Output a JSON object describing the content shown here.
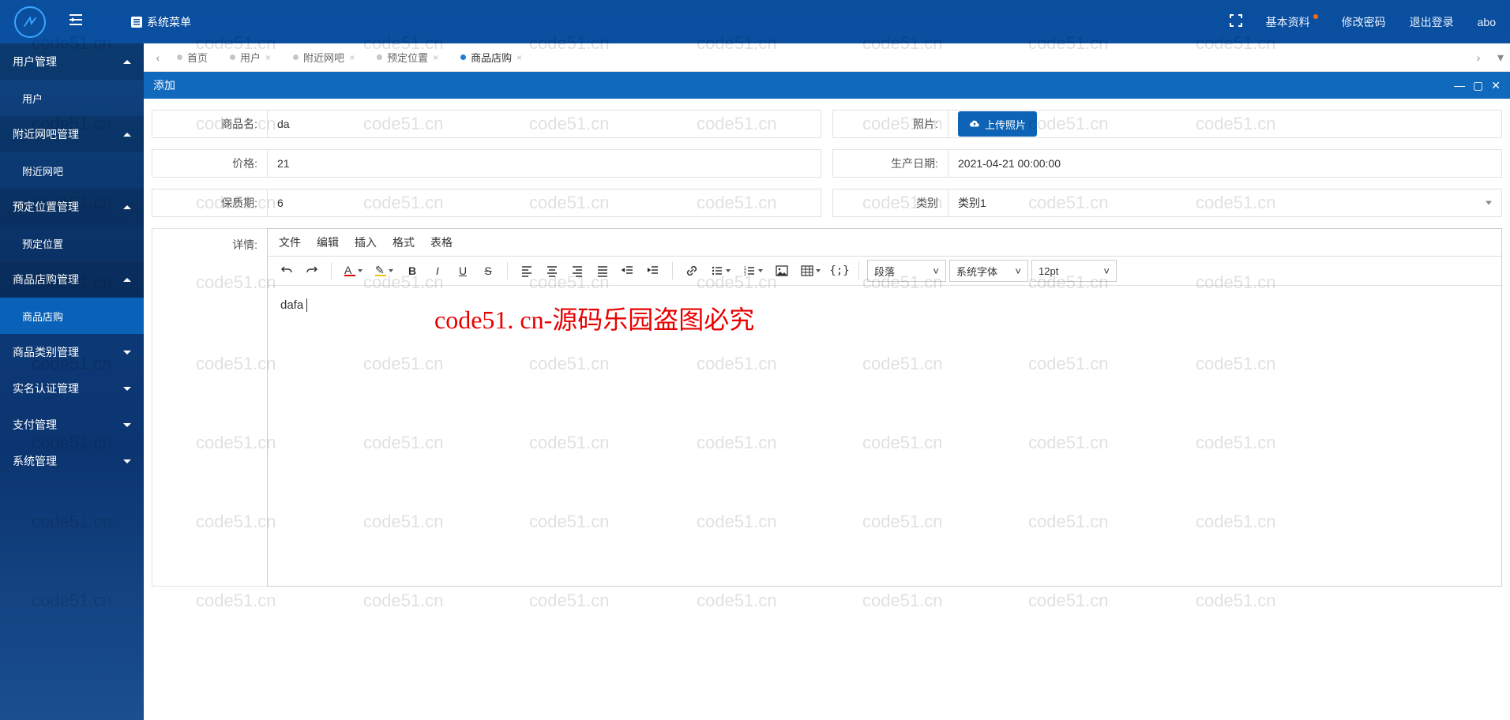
{
  "watermark_text": "code51.cn",
  "watermark_center": "code51. cn-源码乐园盗图必究",
  "header": {
    "sysmenu": "系统菜单",
    "profile": "基本资料",
    "password": "修改密码",
    "logout": "退出登录",
    "user": "abo"
  },
  "sidebar": {
    "groups": [
      {
        "label": "用户管理",
        "expanded": true,
        "children": [
          {
            "label": "用户"
          }
        ]
      },
      {
        "label": "附近网吧管理",
        "expanded": true,
        "children": [
          {
            "label": "附近网吧"
          }
        ]
      },
      {
        "label": "预定位置管理",
        "expanded": true,
        "children": [
          {
            "label": "预定位置"
          }
        ]
      },
      {
        "label": "商品店购管理",
        "expanded": true,
        "children": [
          {
            "label": "商品店购",
            "active": true
          }
        ]
      },
      {
        "label": "商品类别管理",
        "expanded": false
      },
      {
        "label": "实名认证管理",
        "expanded": false
      },
      {
        "label": "支付管理",
        "expanded": false
      },
      {
        "label": "系统管理",
        "expanded": false
      }
    ]
  },
  "tabs": {
    "items": [
      {
        "label": "首页",
        "closable": false
      },
      {
        "label": "用户",
        "closable": true
      },
      {
        "label": "附近网吧",
        "closable": true
      },
      {
        "label": "预定位置",
        "closable": true
      },
      {
        "label": "商品店购",
        "closable": true,
        "active": true
      }
    ]
  },
  "panel": {
    "title": "添加"
  },
  "form": {
    "name_label": "商品名:",
    "name_value": "da",
    "photo_label": "照片:",
    "upload_label": "上传照片",
    "price_label": "价格:",
    "price_value": "21",
    "date_label": "生产日期:",
    "date_value": "2021-04-21 00:00:00",
    "shelf_label": "保质期:",
    "shelf_value": "6",
    "category_label": "类别",
    "category_value": "类别1",
    "detail_label": "详情:"
  },
  "editor": {
    "menu": {
      "file": "文件",
      "edit": "编辑",
      "insert": "插入",
      "format": "格式",
      "table": "表格"
    },
    "block": "段落",
    "font": "系统字体",
    "size": "12pt",
    "content": "dafa"
  }
}
